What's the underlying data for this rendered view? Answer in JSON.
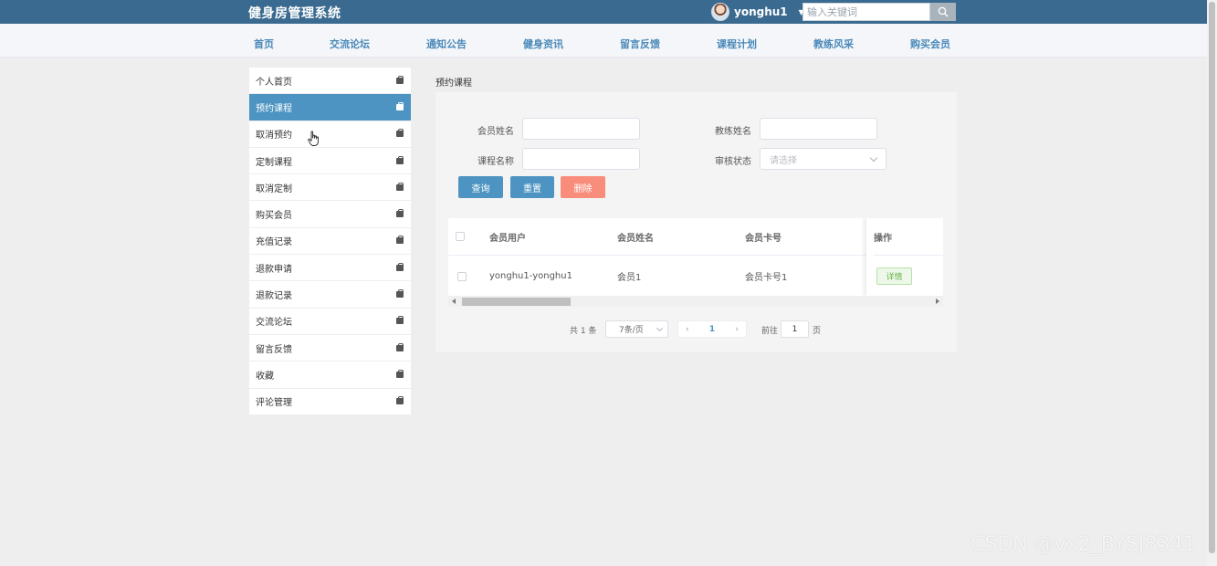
{
  "header": {
    "brand": "健身房管理系统",
    "username": "yonghu1",
    "search_placeholder": "输入关键词"
  },
  "nav": [
    "首页",
    "交流论坛",
    "通知公告",
    "健身资讯",
    "留言反馈",
    "课程计划",
    "教练风采",
    "购买会员"
  ],
  "sidebar": {
    "active_index": 1,
    "items": [
      "个人首页",
      "预约课程",
      "取消预约",
      "定制课程",
      "取消定制",
      "购买会员",
      "充值记录",
      "退款申请",
      "退款记录",
      "交流论坛",
      "留言反馈",
      "收藏",
      "评论管理"
    ]
  },
  "main": {
    "title": "预约课程",
    "filters": {
      "member_name_label": "会员姓名",
      "coach_name_label": "教练姓名",
      "course_name_label": "课程名称",
      "review_status_label": "审核状态",
      "review_status_placeholder": "请选择"
    },
    "buttons": {
      "query": "查询",
      "reset": "重置",
      "delete": "删除"
    },
    "table": {
      "columns": [
        "会员用户",
        "会员姓名",
        "会员卡号"
      ],
      "op_column": "操作",
      "rows": [
        {
          "user": "yonghu1-yonghu1",
          "name": "会员1",
          "card": "会员卡号1",
          "action": "详情"
        }
      ]
    },
    "pagination": {
      "total": "共 1 条",
      "page_size": "7条/页",
      "current_page": "1",
      "goto_label": "前往",
      "goto_value": "1",
      "page_unit": "页"
    }
  },
  "watermark": "CSDN @vx2_BYSJ8341",
  "colors": {
    "header_bg": "#3a6a8f",
    "accent": "#4d94c2",
    "danger": "#f88d7c",
    "success": "#67b34a"
  }
}
